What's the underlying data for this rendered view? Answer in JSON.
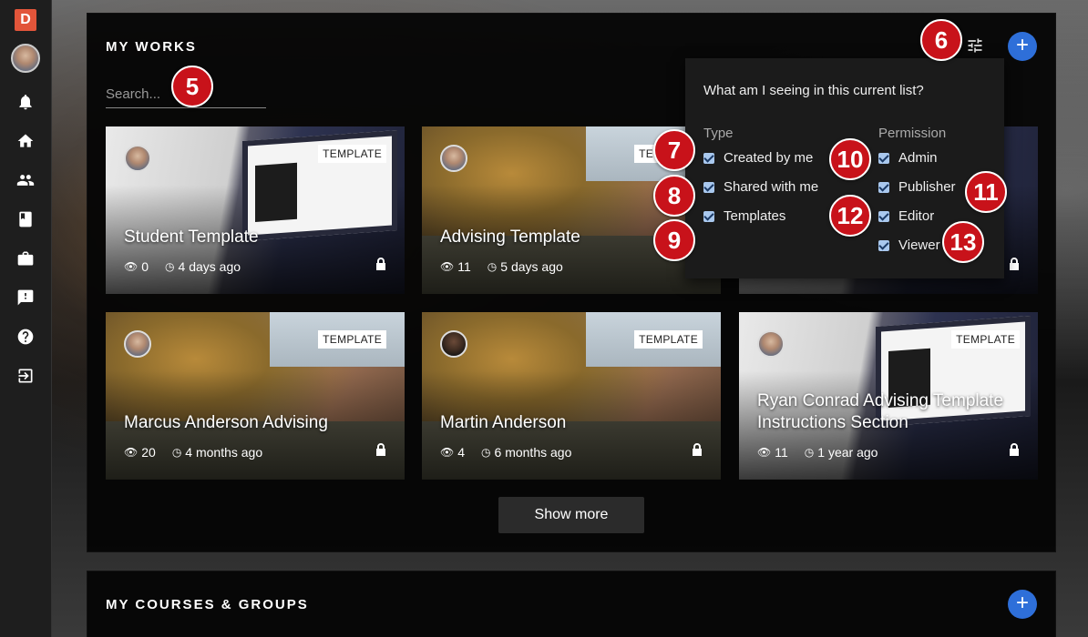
{
  "app": {
    "logo_letter": "D"
  },
  "sidebar": {
    "icons": [
      "bell-icon",
      "home-icon",
      "people-icon",
      "book-icon",
      "briefcase-icon",
      "feedback-icon",
      "help-icon",
      "logout-icon"
    ]
  },
  "my_works": {
    "title": "MY WORKS",
    "add_label": "+",
    "search_placeholder": "Search...",
    "show_more": "Show more",
    "cards": [
      {
        "title": "Student Template",
        "badge": "TEMPLATE",
        "views": "0",
        "age": "4 days ago",
        "bg": "laptop",
        "avatar": "light"
      },
      {
        "title": "Advising Template",
        "badge": "TEMPLATE",
        "views": "11",
        "age": "5 days ago",
        "bg": "bridge",
        "avatar": "light"
      },
      {
        "title": "Marcus Anderson Advising",
        "badge": "TEMPLATE",
        "views": "20",
        "age": "4 months ago",
        "bg": "bridge",
        "avatar": "light"
      },
      {
        "title": "Martin Anderson",
        "badge": "TEMPLATE",
        "views": "4",
        "age": "6 months ago",
        "bg": "bridge",
        "avatar": "dark"
      },
      {
        "title": "Ryan Conrad Advising Template Instructions Section",
        "badge": "TEMPLATE",
        "views": "11",
        "age": "1 year ago",
        "bg": "laptop",
        "avatar": "light"
      }
    ]
  },
  "filter_popup": {
    "question": "What am I seeing in this current list?",
    "type_heading": "Type",
    "permission_heading": "Permission",
    "type_options": [
      "Created by me",
      "Shared with me",
      "Templates"
    ],
    "permission_options": [
      "Admin",
      "Publisher",
      "Editor",
      "Viewer"
    ]
  },
  "my_courses": {
    "title": "MY COURSES & GROUPS",
    "add_label": "+"
  },
  "markers": {
    "m5": "5",
    "m6": "6",
    "m7": "7",
    "m8": "8",
    "m9": "9",
    "m10": "10",
    "m11": "11",
    "m12": "12",
    "m13": "13"
  }
}
